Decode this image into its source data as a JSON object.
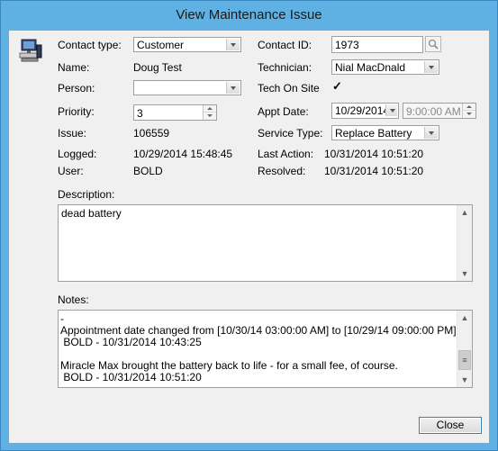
{
  "window": {
    "title": "View Maintenance Issue"
  },
  "icons": {
    "app_icon": "computer-workstation-icon",
    "lookup_icon": "magnifier-icon"
  },
  "contact_type": {
    "label": "Contact type:",
    "value": "Customer"
  },
  "contact_id": {
    "label": "Contact ID:",
    "value": "1973"
  },
  "name": {
    "label": "Name:",
    "value": "Doug Test"
  },
  "technician": {
    "label": "Technician:",
    "value": "Nial MacDnald"
  },
  "person": {
    "label": "Person:",
    "value": ""
  },
  "tech_on_site": {
    "label": "Tech On Site",
    "checked": true,
    "mark": "✓"
  },
  "priority": {
    "label": "Priority:",
    "value": "3"
  },
  "appt_date": {
    "label": "Appt Date:",
    "date": "10/29/2014",
    "time": "9:00:00 AM"
  },
  "issue": {
    "label": "Issue:",
    "value": "106559"
  },
  "service_type": {
    "label": "Service Type:",
    "value": "Replace Battery"
  },
  "logged": {
    "label": "Logged:",
    "value": "10/29/2014 15:48:45"
  },
  "last_action": {
    "label": "Last Action:",
    "value": "10/31/2014 10:51:20"
  },
  "user": {
    "label": "User:",
    "value": "BOLD"
  },
  "resolved": {
    "label": "Resolved:",
    "value": "10/31/2014 10:51:20"
  },
  "description": {
    "label": "Description:",
    "value": "dead battery"
  },
  "notes": {
    "label": "Notes:",
    "lines": [
      "-",
      "Appointment date changed from [10/30/14 03:00:00 AM] to [10/29/14 09:00:00 PM].",
      " BOLD - 10/31/2014 10:43:25",
      "",
      "Miracle Max brought the battery back to life - for a small fee, of course.",
      " BOLD - 10/31/2014 10:51:20"
    ]
  },
  "buttons": {
    "close": "Close"
  },
  "scroll": {
    "up": "▲",
    "down": "▼",
    "grip": "≡"
  }
}
